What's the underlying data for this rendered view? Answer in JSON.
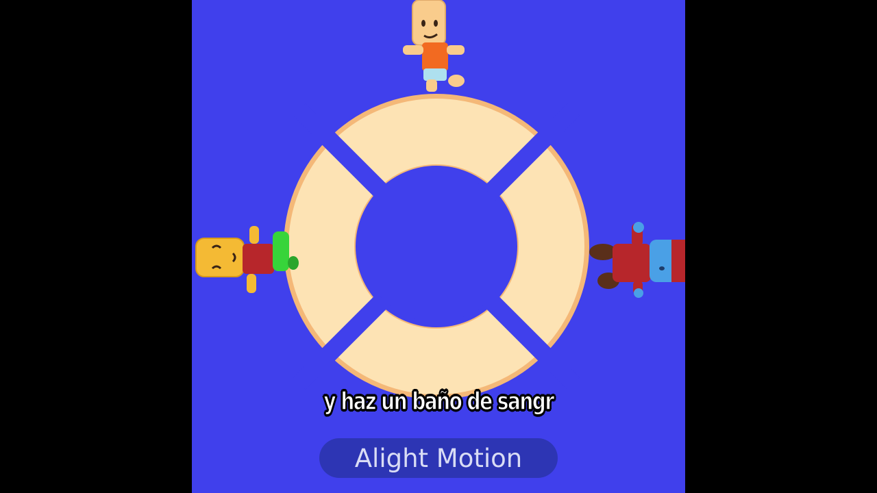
{
  "caption": "y haz un baño de sangr",
  "watermark": "Alight Motion",
  "colors": {
    "letterbox": "#000000",
    "background": "#4040ec",
    "ring_fill": "#fde3b4",
    "ring_edge": "#f4b878",
    "watermark_bg": "#2a34aa",
    "watermark_text": "#d9dcf5"
  },
  "scene": {
    "object": "lifebuoy-ring",
    "characters": [
      "top-character",
      "left-character",
      "right-character"
    ]
  }
}
